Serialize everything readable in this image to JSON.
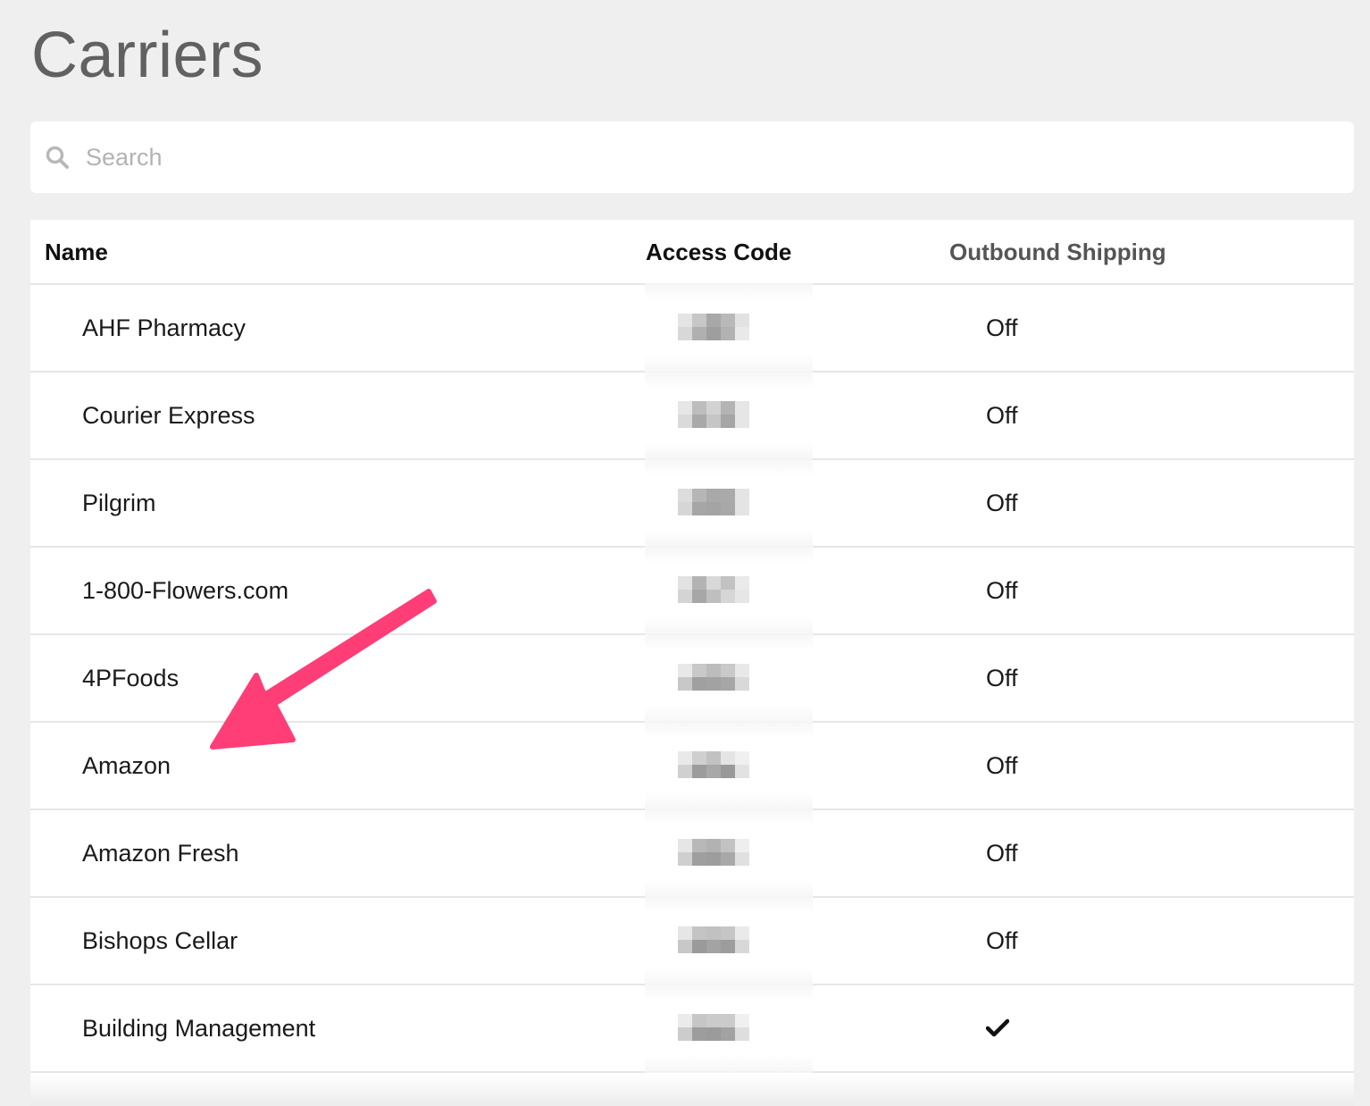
{
  "page": {
    "title": "Carriers"
  },
  "search": {
    "placeholder": "Search",
    "value": "",
    "icon": "search-icon"
  },
  "table": {
    "columns": {
      "name": "Name",
      "access_code": "Access Code",
      "outbound_shipping": "Outbound Shipping"
    },
    "rows": [
      {
        "name": "AHF Pharmacy",
        "access_code": "redacted",
        "outbound": "Off"
      },
      {
        "name": "Courier Express",
        "access_code": "redacted",
        "outbound": "Off"
      },
      {
        "name": "Pilgrim",
        "access_code": "redacted",
        "outbound": "Off"
      },
      {
        "name": "1-800-Flowers.com",
        "access_code": "redacted",
        "outbound": "Off"
      },
      {
        "name": "4PFoods",
        "access_code": "redacted",
        "outbound": "Off"
      },
      {
        "name": "Amazon",
        "access_code": "redacted",
        "outbound": "Off"
      },
      {
        "name": "Amazon Fresh",
        "access_code": "redacted",
        "outbound": "Off"
      },
      {
        "name": "Bishops Cellar",
        "access_code": "redacted",
        "outbound": "Off"
      },
      {
        "name": "Building Management",
        "access_code": "redacted",
        "outbound": "checkmark"
      }
    ]
  },
  "annotation": {
    "type": "arrow",
    "color": "#ff3d77",
    "points_to": "Amazon"
  },
  "colors": {
    "background": "#efefef",
    "card": "#ffffff",
    "title": "#616161",
    "divider": "#e6e6e6",
    "placeholder": "#b3b3b3"
  }
}
